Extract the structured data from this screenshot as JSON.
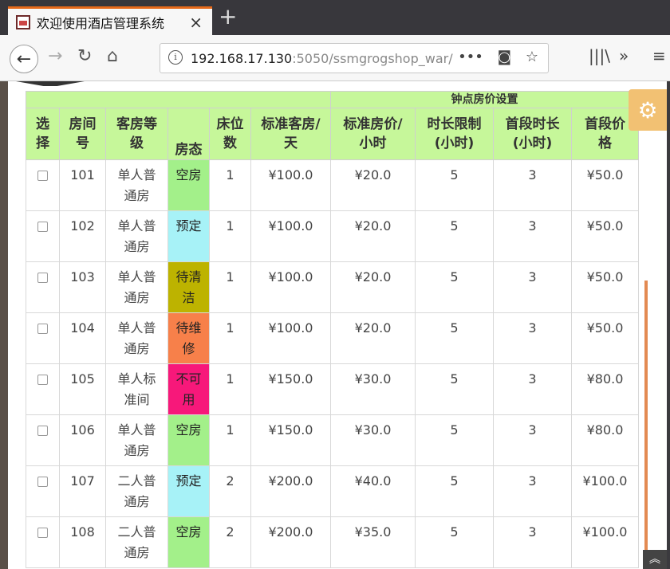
{
  "browser": {
    "tab_title": "欢迎使用酒店管理系统",
    "tab_close": "×",
    "new_tab": "+",
    "url_host": "192.168.17.130",
    "url_rest": ":5050/ssmgrogshop_war/",
    "url_more": "•••",
    "icons": [
      "back-arrow-icon",
      "forward-arrow-icon",
      "reload-icon",
      "home-icon",
      "info-icon",
      "pocket-icon",
      "star-icon",
      "library-icon",
      "overflow-icon",
      "menu-icon"
    ]
  },
  "table": {
    "group_header": "钟点房价设置",
    "headers": [
      "选择",
      "房间号",
      "客房等级",
      "房态",
      "床位数",
      "标准客房/天",
      "标准房价/小时",
      "时长限制(小时)",
      "首段时长(小时)",
      "首段价格"
    ],
    "header_lines": [
      [
        "选",
        "择"
      ],
      [
        "房间",
        "号"
      ],
      [
        "客房等",
        "级"
      ],
      [
        "房态"
      ],
      [
        "床位",
        "数"
      ],
      [
        "标准客房/",
        "天"
      ],
      [
        "标准房价/",
        "小时"
      ],
      [
        "时长限制",
        "(小时)"
      ],
      [
        "首段时长",
        "(小时)"
      ],
      [
        "首段价",
        "格"
      ]
    ],
    "rows": [
      {
        "room": "101",
        "level": [
          "单人普",
          "通房"
        ],
        "state": [
          "空房"
        ],
        "state_color": "#a3f08a",
        "beds": "1",
        "std_day": "¥100.0",
        "std_hour": "¥20.0",
        "limit": "5",
        "first_len": "3",
        "first_price": "¥50.0"
      },
      {
        "room": "102",
        "level": [
          "单人普",
          "通房"
        ],
        "state": [
          "预定"
        ],
        "state_color": "#a7f2f7",
        "beds": "1",
        "std_day": "¥100.0",
        "std_hour": "¥20.0",
        "limit": "5",
        "first_len": "3",
        "first_price": "¥50.0"
      },
      {
        "room": "103",
        "level": [
          "单人普",
          "通房"
        ],
        "state": [
          "待清",
          "洁"
        ],
        "state_color": "#bdb300",
        "beds": "1",
        "std_day": "¥100.0",
        "std_hour": "¥20.0",
        "limit": "5",
        "first_len": "3",
        "first_price": "¥50.0"
      },
      {
        "room": "104",
        "level": [
          "单人普",
          "通房"
        ],
        "state": [
          "待维",
          "修"
        ],
        "state_color": "#f7804a",
        "beds": "1",
        "std_day": "¥100.0",
        "std_hour": "¥20.0",
        "limit": "5",
        "first_len": "3",
        "first_price": "¥50.0"
      },
      {
        "room": "105",
        "level": [
          "单人标",
          "准间"
        ],
        "state": [
          "不可",
          "用"
        ],
        "state_color": "#f7187a",
        "beds": "1",
        "std_day": "¥150.0",
        "std_hour": "¥30.0",
        "limit": "5",
        "first_len": "3",
        "first_price": "¥80.0"
      },
      {
        "room": "106",
        "level": [
          "单人普",
          "通房"
        ],
        "state": [
          "空房"
        ],
        "state_color": "#a3f08a",
        "beds": "1",
        "std_day": "¥150.0",
        "std_hour": "¥30.0",
        "limit": "5",
        "first_len": "3",
        "first_price": "¥80.0"
      },
      {
        "room": "107",
        "level": [
          "二人普",
          "通房"
        ],
        "state": [
          "预定"
        ],
        "state_color": "#a7f2f7",
        "beds": "2",
        "std_day": "¥200.0",
        "std_hour": "¥40.0",
        "limit": "5",
        "first_len": "3",
        "first_price": "¥100.0"
      },
      {
        "room": "108",
        "level": [
          "二人普",
          "通房"
        ],
        "state": [
          "空房"
        ],
        "state_color": "#a3f08a",
        "beds": "2",
        "std_day": "¥200.0",
        "std_hour": "¥35.0",
        "limit": "5",
        "first_len": "3",
        "first_price": "¥100.0"
      }
    ]
  },
  "widgets": {
    "totop": "»"
  }
}
